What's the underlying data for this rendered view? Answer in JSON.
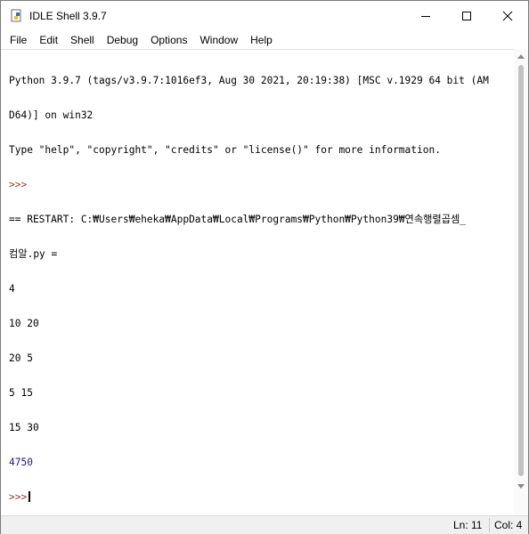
{
  "window": {
    "title": "IDLE Shell 3.9.7",
    "icon": "python-icon"
  },
  "title_buttons": {
    "minimize_icon": "minimize-icon",
    "maximize_icon": "maximize-icon",
    "close_icon": "close-icon"
  },
  "menu": {
    "items": [
      "File",
      "Edit",
      "Shell",
      "Debug",
      "Options",
      "Window",
      "Help"
    ]
  },
  "shell": {
    "banner_line1": "Python 3.9.7 (tags/v3.9.7:1016ef3, Aug 30 2021, 20:19:38) [MSC v.1929 64 bit (AM",
    "banner_line2": "D64)] on win32",
    "banner_line3": "Type \"help\", \"copyright\", \"credits\" or \"license()\" for more information.",
    "prompt1": ">>>",
    "restart_line1": "== RESTART: C:₩Users₩eheka₩AppData₩Local₩Programs₩Python₩Python39₩연속행렬곱셈_",
    "restart_line2": "컴알.py =",
    "input_lines": [
      "4",
      "10 20",
      "20 5",
      "5 15",
      "15 30"
    ],
    "result": "4750",
    "prompt2": ">>>"
  },
  "status": {
    "line": "Ln: 11",
    "col": "Col: 4"
  },
  "colors": {
    "prompt": "#8b3c2a",
    "stdout": "#1a1a8c",
    "background": "#ffffff"
  }
}
